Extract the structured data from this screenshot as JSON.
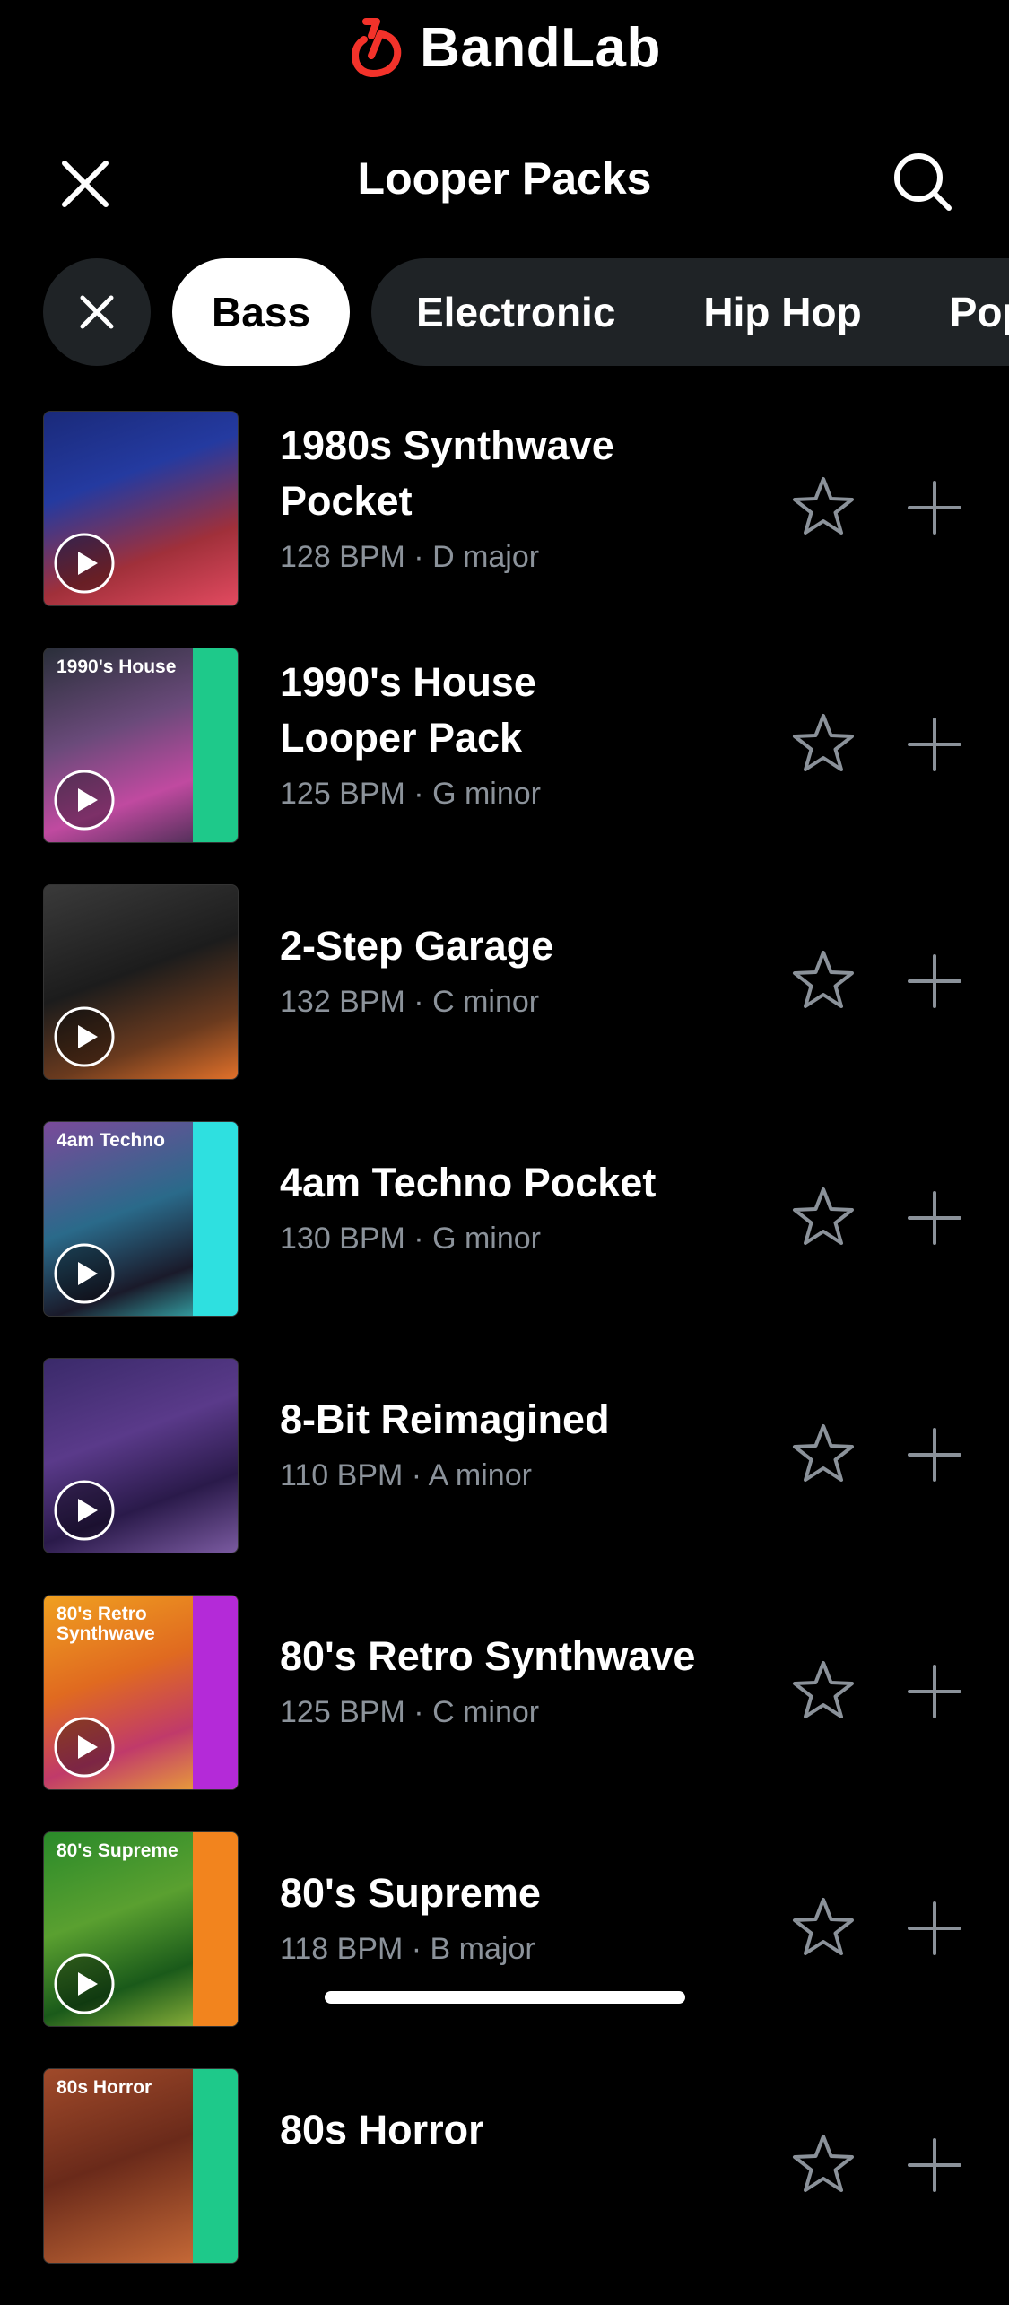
{
  "app": {
    "brand": "BandLab"
  },
  "header": {
    "title": "Looper Packs"
  },
  "filters": {
    "active": "Bass",
    "others": [
      "Electronic",
      "Hip Hop",
      "Pop"
    ]
  },
  "packs": [
    {
      "name_line1": "1980s Synthwave",
      "name_line2": "Pocket",
      "meta": "128 BPM · D major",
      "cover_label": ""
    },
    {
      "name_line1": "1990's House",
      "name_line2": "Looper Pack",
      "meta": "125 BPM · G minor",
      "cover_label": "1990's House"
    },
    {
      "name_line1": "2-Step Garage",
      "name_line2": "",
      "meta": "132 BPM · C minor",
      "cover_label": ""
    },
    {
      "name_line1": "4am Techno Pocket",
      "name_line2": "",
      "meta": "130 BPM · G minor",
      "cover_label": "4am Techno"
    },
    {
      "name_line1": "8-Bit Reimagined",
      "name_line2": "",
      "meta": "110 BPM · A minor",
      "cover_label": ""
    },
    {
      "name_line1": "80's Retro Synthwave",
      "name_line2": "",
      "meta": "125 BPM · C minor",
      "cover_label": "80's Retro Synthwave"
    },
    {
      "name_line1": "80's Supreme",
      "name_line2": "",
      "meta": "118 BPM · B major",
      "cover_label": "80's Supreme"
    },
    {
      "name_line1": "80s Horror",
      "name_line2": "",
      "meta": "",
      "cover_label": "80s Horror"
    }
  ],
  "colors": {
    "brand_red": "#f3322a",
    "chip_bg": "#1f2326",
    "icon_gray": "#8b929a",
    "meta_text": "#8b929a"
  },
  "icons": {
    "brand": "bandlab-logo-icon",
    "close": "close-icon",
    "search": "search-icon",
    "clear_filter": "close-icon",
    "play": "play-icon",
    "favorite": "star-outline-icon",
    "add": "plus-icon"
  }
}
